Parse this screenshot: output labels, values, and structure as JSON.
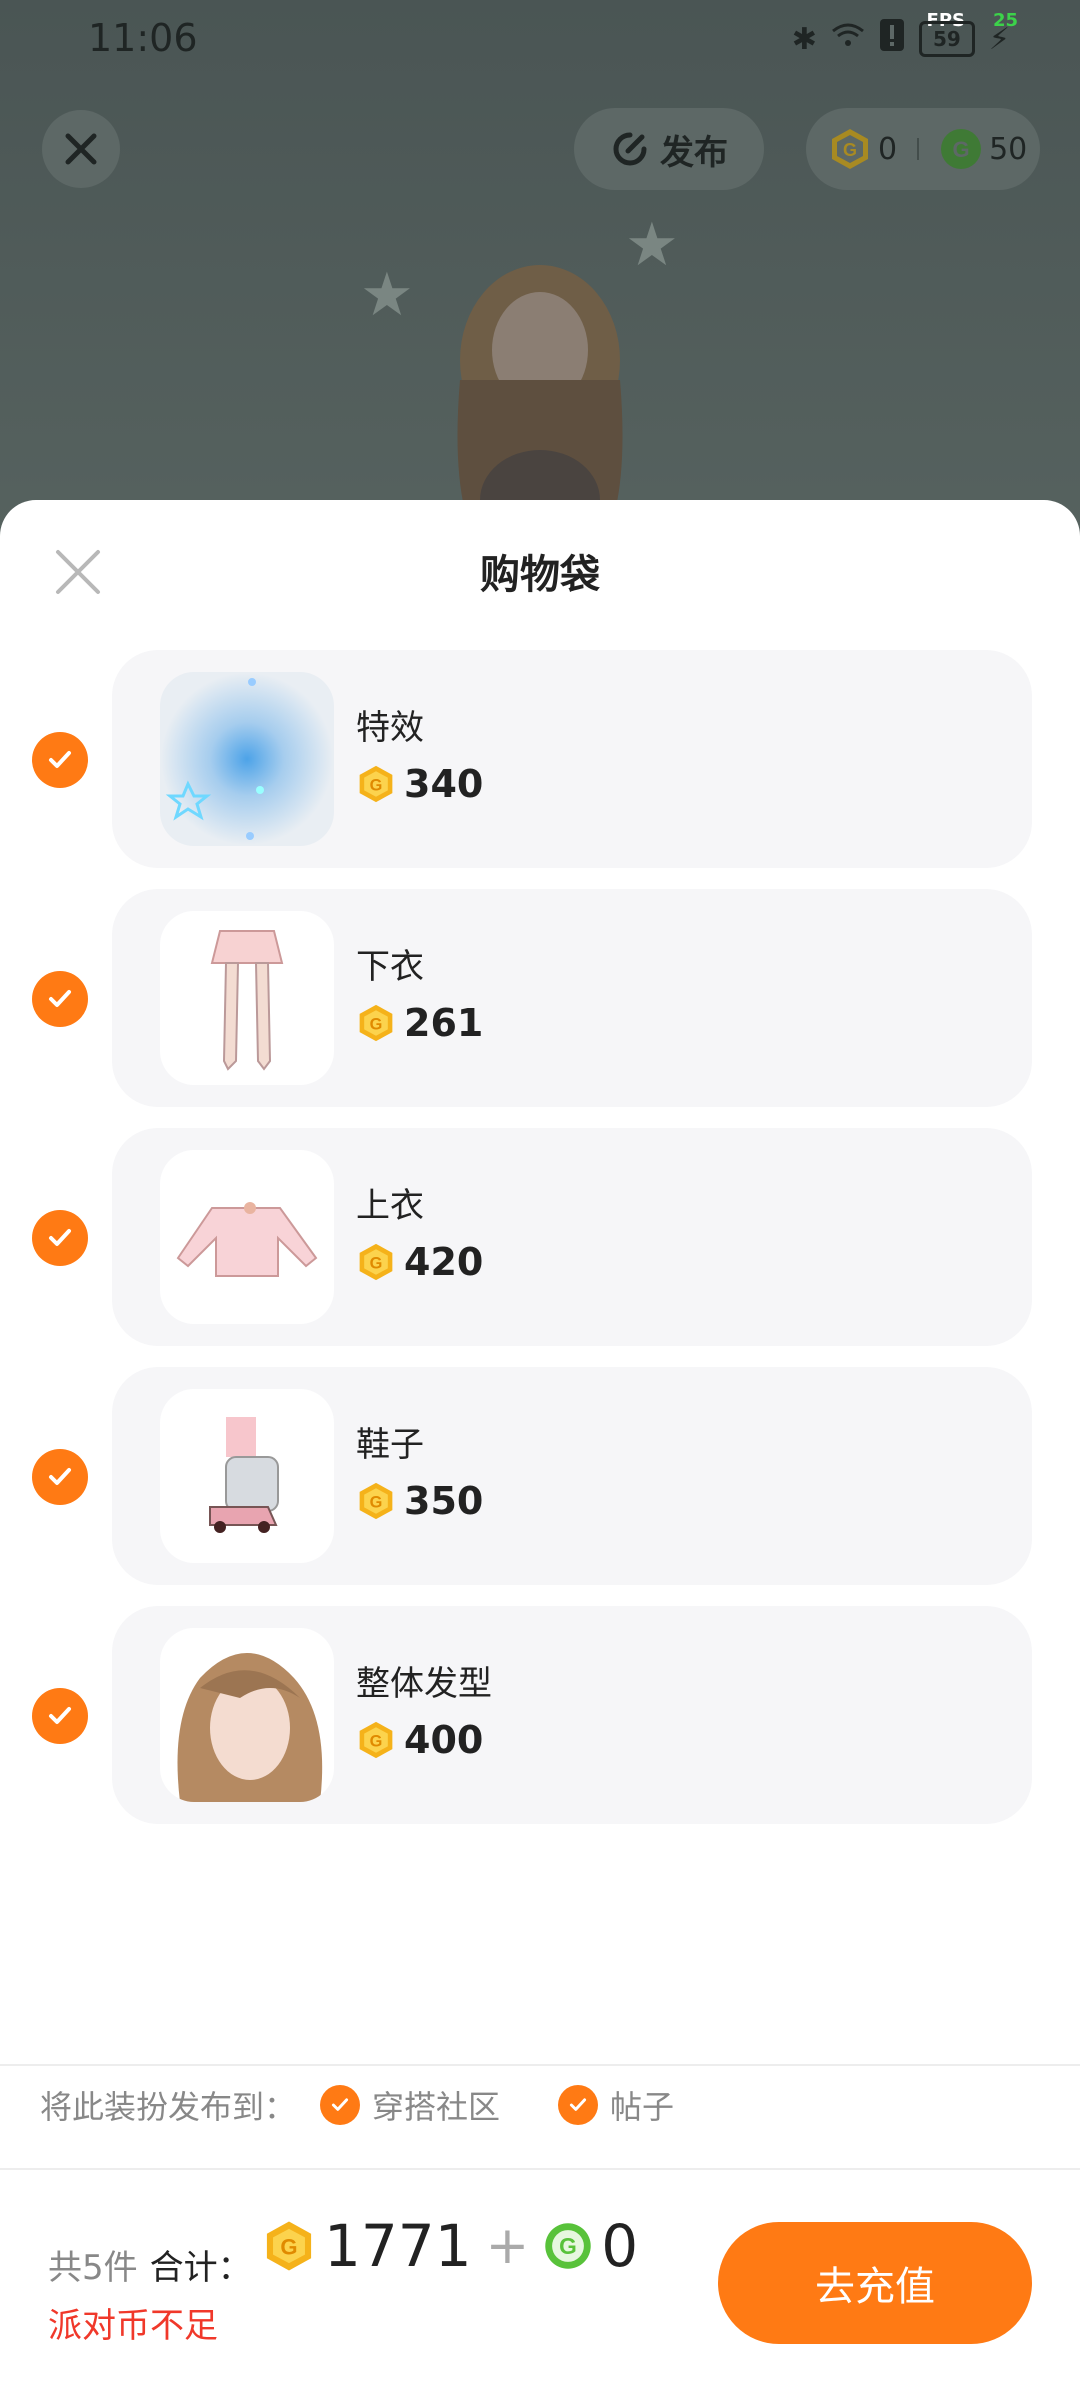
{
  "status_bar": {
    "time": "11:06",
    "battery": "59",
    "fps_label": "FPS",
    "fps_value": "25"
  },
  "top_bar": {
    "publish_label": "发布",
    "gold_balance": "0",
    "green_balance": "50"
  },
  "sheet": {
    "title": "购物袋"
  },
  "items": [
    {
      "name": "特效",
      "price": "340"
    },
    {
      "name": "下衣",
      "price": "261"
    },
    {
      "name": "上衣",
      "price": "420"
    },
    {
      "name": "鞋子",
      "price": "350"
    },
    {
      "name": "整体发型",
      "price": "400"
    }
  ],
  "publish_to": {
    "label": "将此装扮发布到：",
    "options": [
      {
        "label": "穿搭社区"
      },
      {
        "label": "帖子"
      }
    ]
  },
  "footer": {
    "count_label": "共5件",
    "total_label": "合计：",
    "gold_total": "1771",
    "plus": "+",
    "green_total": "0",
    "warning": "派对币不足",
    "recharge_label": "去充值"
  },
  "colors": {
    "accent": "#ff7a14",
    "warning": "#f0382a",
    "gold_coin": "#f5b21a",
    "green_coin": "#58c23a"
  }
}
